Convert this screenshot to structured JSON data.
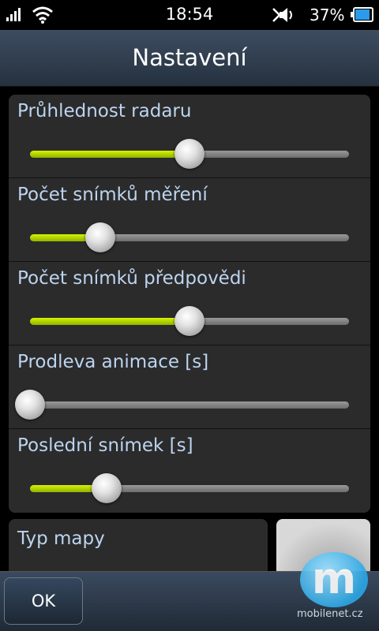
{
  "status_bar": {
    "time": "18:54",
    "battery_percent": "37%",
    "signal_icon": "signal-bars-icon",
    "wifi_icon": "wifi-icon",
    "sound_icon": "speaker-icon",
    "battery_icon": "battery-icon",
    "battery_level": 0.37
  },
  "title_bar": {
    "title": "Nastavení"
  },
  "settings": [
    {
      "label": "Průhlednost radaru",
      "value": 0.5
    },
    {
      "label": "Počet snímků měření",
      "value": 0.22
    },
    {
      "label": "Počet snímků předpovědi",
      "value": 0.5
    },
    {
      "label": "Prodleva animace  [s]",
      "value": 0.0
    },
    {
      "label": "Poslední snímek [s]",
      "value": 0.24
    }
  ],
  "map": {
    "label": "Typ mapy"
  },
  "toolbar": {
    "ok_label": "OK"
  },
  "watermark": {
    "logo_letter": "m",
    "text": "mobilenet.cz"
  },
  "colors": {
    "accent_fill": "#b4d800",
    "label": "#bcd4f0",
    "title_bar": "#2f3d4e"
  }
}
